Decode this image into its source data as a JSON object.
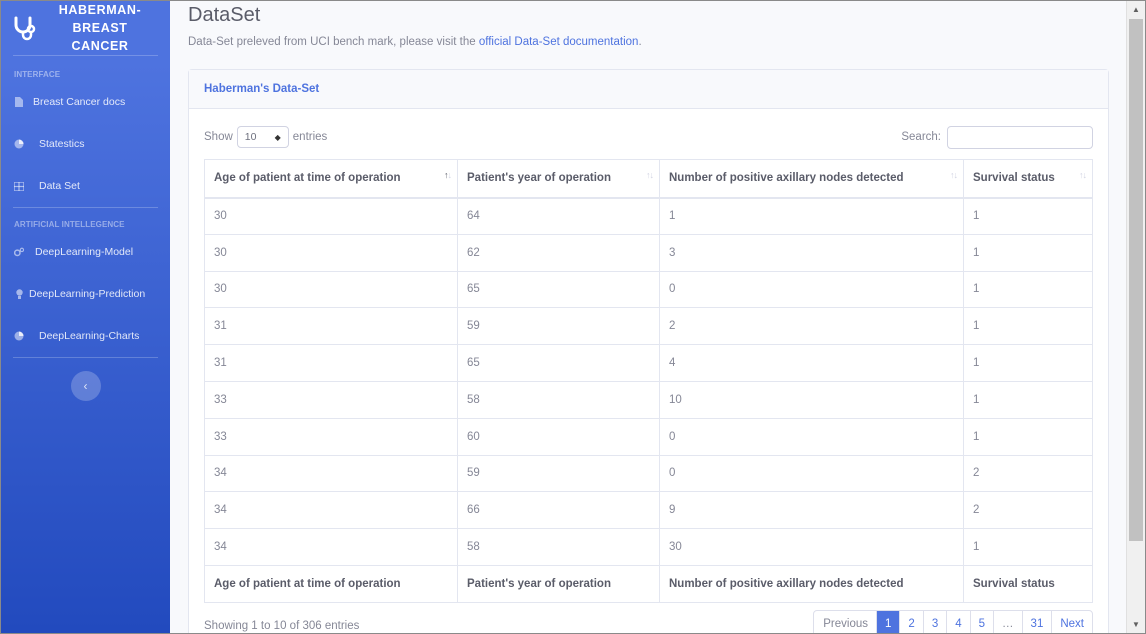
{
  "sidebar": {
    "brand_line1": "HABERMAN-",
    "brand_line2": "BREAST CANCER",
    "heading_interface": "INTERFACE",
    "heading_ai": "ARTIFICIAL INTELLEGENCE",
    "items": [
      {
        "label": "Breast Cancer docs",
        "icon": "file-icon"
      },
      {
        "label": "Statestics",
        "icon": "pie-chart-icon"
      },
      {
        "label": "Data Set",
        "icon": "table-icon"
      },
      {
        "label": "DeepLearning-Model",
        "icon": "cogs-icon"
      },
      {
        "label": "DeepLearning-Prediction",
        "icon": "lightbulb-icon"
      },
      {
        "label": "DeepLearning-Charts",
        "icon": "pie-chart-icon"
      }
    ],
    "toggle_glyph": "‹"
  },
  "page": {
    "title": "DataSet",
    "desc_prefix": "Data-Set preleved from UCI bench mark, please visit the ",
    "desc_link": "official Data-Set documentation",
    "desc_suffix": "."
  },
  "card": {
    "header": "Haberman's Data-Set",
    "show_label": "Show",
    "entries_value": "10",
    "entries_label": "entries",
    "search_label": "Search:",
    "search_value": ""
  },
  "table": {
    "columns": [
      "Age of patient at time of operation",
      "Patient's year of operation",
      "Number of positive axillary nodes detected",
      "Survival status"
    ],
    "rows": [
      [
        "30",
        "64",
        "1",
        "1"
      ],
      [
        "30",
        "62",
        "3",
        "1"
      ],
      [
        "30",
        "65",
        "0",
        "1"
      ],
      [
        "31",
        "59",
        "2",
        "1"
      ],
      [
        "31",
        "65",
        "4",
        "1"
      ],
      [
        "33",
        "58",
        "10",
        "1"
      ],
      [
        "33",
        "60",
        "0",
        "1"
      ],
      [
        "34",
        "59",
        "0",
        "2"
      ],
      [
        "34",
        "66",
        "9",
        "2"
      ],
      [
        "34",
        "58",
        "30",
        "1"
      ]
    ],
    "sorted_column": 0
  },
  "footer": {
    "info": "Showing 1 to 10 of 306 entries",
    "pagination": [
      "Previous",
      "1",
      "2",
      "3",
      "4",
      "5",
      "…",
      "31",
      "Next"
    ],
    "active_page": "1"
  },
  "colors": {
    "primary": "#4e73df",
    "sidebar_bottom": "#224abe"
  }
}
